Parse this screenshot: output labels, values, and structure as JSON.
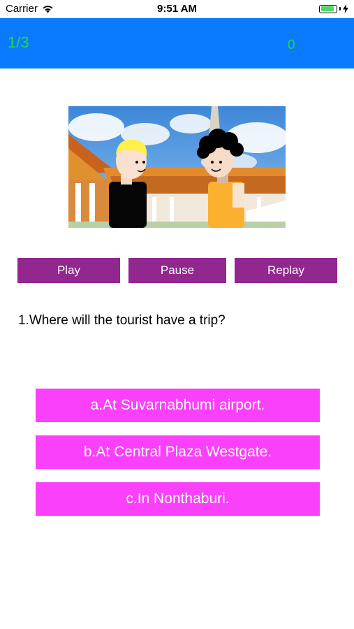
{
  "status_bar": {
    "carrier": "Carrier",
    "time": "9:51 AM",
    "battery_level": 0.9,
    "icons": [
      "wifi-icon",
      "battery-icon",
      "charging-bolt-icon"
    ]
  },
  "header": {
    "progress": "1/3",
    "score": "0",
    "background_color": "#0a7aff",
    "text_color": "#22d84a"
  },
  "scene": {
    "content": "illustration-two-cartoon-tourists-temple"
  },
  "controls": {
    "play_label": "Play",
    "pause_label": "Pause",
    "replay_label": "Replay",
    "button_color": "#92278f"
  },
  "question": {
    "text": "1.Where will the tourist have a trip?"
  },
  "answers": [
    {
      "label": "a.At Suvarnabhumi airport."
    },
    {
      "label": "b.At Central Plaza Westgate."
    },
    {
      "label": "c.In Nonthaburi."
    }
  ],
  "answer_color": "#fb40fb"
}
